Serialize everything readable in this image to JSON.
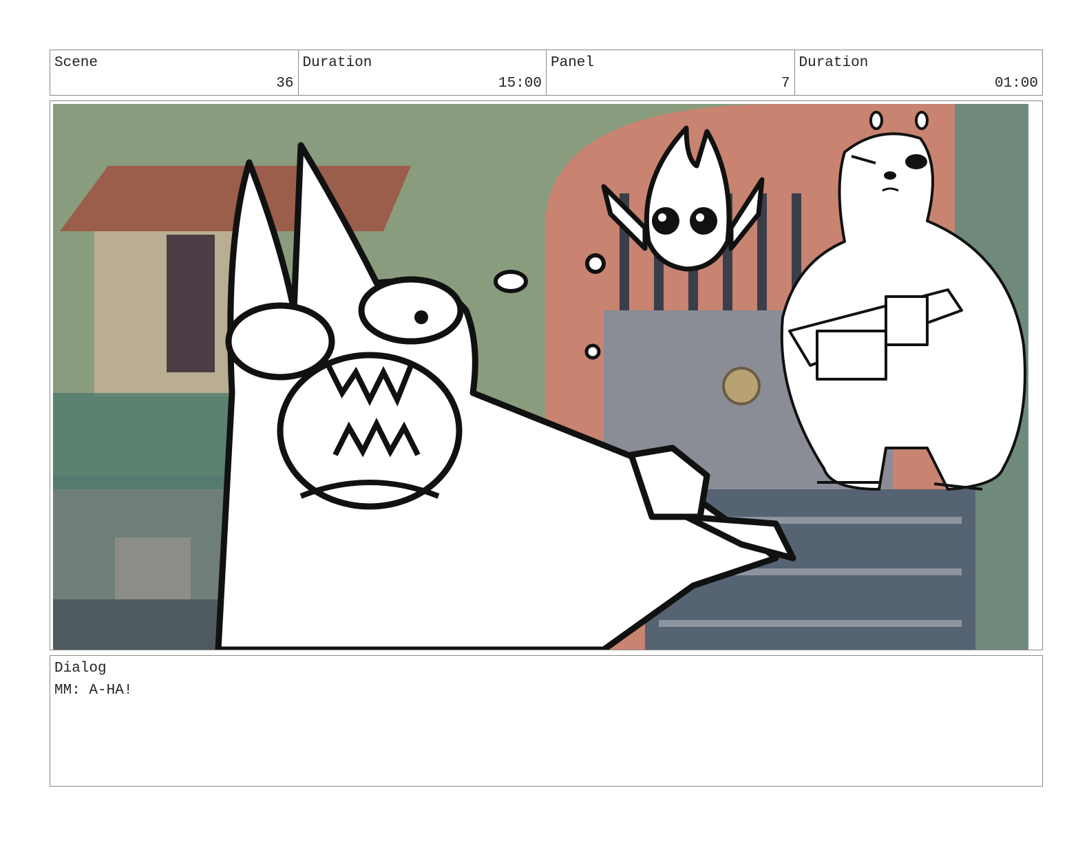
{
  "header": {
    "scene_label": "Scene",
    "scene_value": "36",
    "scene_duration_label": "Duration",
    "scene_duration_value": "15:00",
    "panel_label": "Panel",
    "panel_value": "7",
    "panel_duration_label": "Duration",
    "panel_duration_value": "01:00"
  },
  "dialog": {
    "label": "Dialog",
    "lines": [
      "MM: A-HA!"
    ]
  },
  "colors": {
    "border": "#8a8a8a",
    "wall_green": "#8a9c7e",
    "roof_brown": "#9a5e4a",
    "arch_salmon": "#c88470",
    "door_gray": "#8a8d96",
    "steps_slate": "#566373"
  }
}
